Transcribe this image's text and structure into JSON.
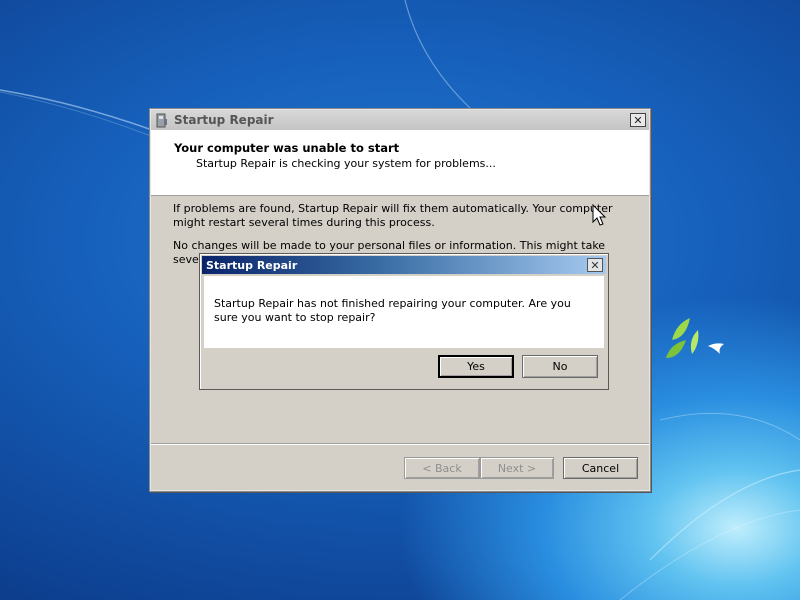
{
  "main_window": {
    "title": "Startup Repair",
    "close_glyph": "✕",
    "header": {
      "title": "Your computer was unable to start",
      "subtitle": "Startup Repair is checking your system for problems..."
    },
    "paragraphs": [
      "If problems are found, Startup Repair will fix them automatically. Your computer might restart several times during this process.",
      "No changes will be made to your personal files or information. This might take several minutes."
    ],
    "buttons": {
      "back": "< Back",
      "next": "Next >",
      "cancel": "Cancel"
    }
  },
  "confirm_dialog": {
    "title": "Startup Repair",
    "close_glyph": "✕",
    "message": "Startup Repair has not finished repairing your computer. Are you sure you want to stop repair?",
    "buttons": {
      "yes": "Yes",
      "no": "No"
    }
  },
  "icons": {
    "window_icon": "startup-repair-icon",
    "cursor": "mouse-pointer-icon"
  }
}
